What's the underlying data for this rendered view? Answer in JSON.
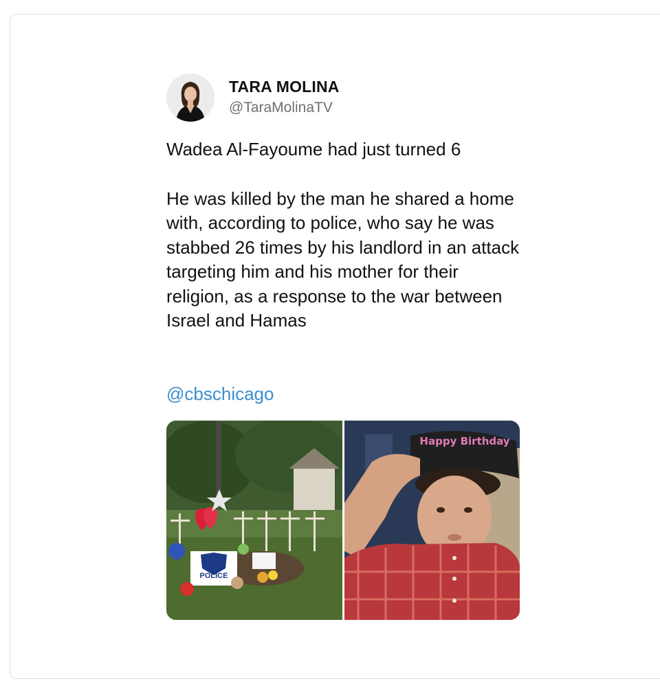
{
  "tweet": {
    "author_name": "TARA MOLINA",
    "author_handle": "@TaraMolinaTV",
    "text_line1": "Wadea Al-Fayoume had just turned 6",
    "text_line2": "He was killed by the man he shared a home with, according to police, who say he was stabbed 26 times by his landlord in an attack targeting him and his mother for their religion, as a response to the war between Israel and Hamas",
    "mention": "@cbschicago"
  },
  "media": {
    "photo1_sign_text": "POLICE",
    "photo2_hat_text": "Happy Birthday"
  }
}
